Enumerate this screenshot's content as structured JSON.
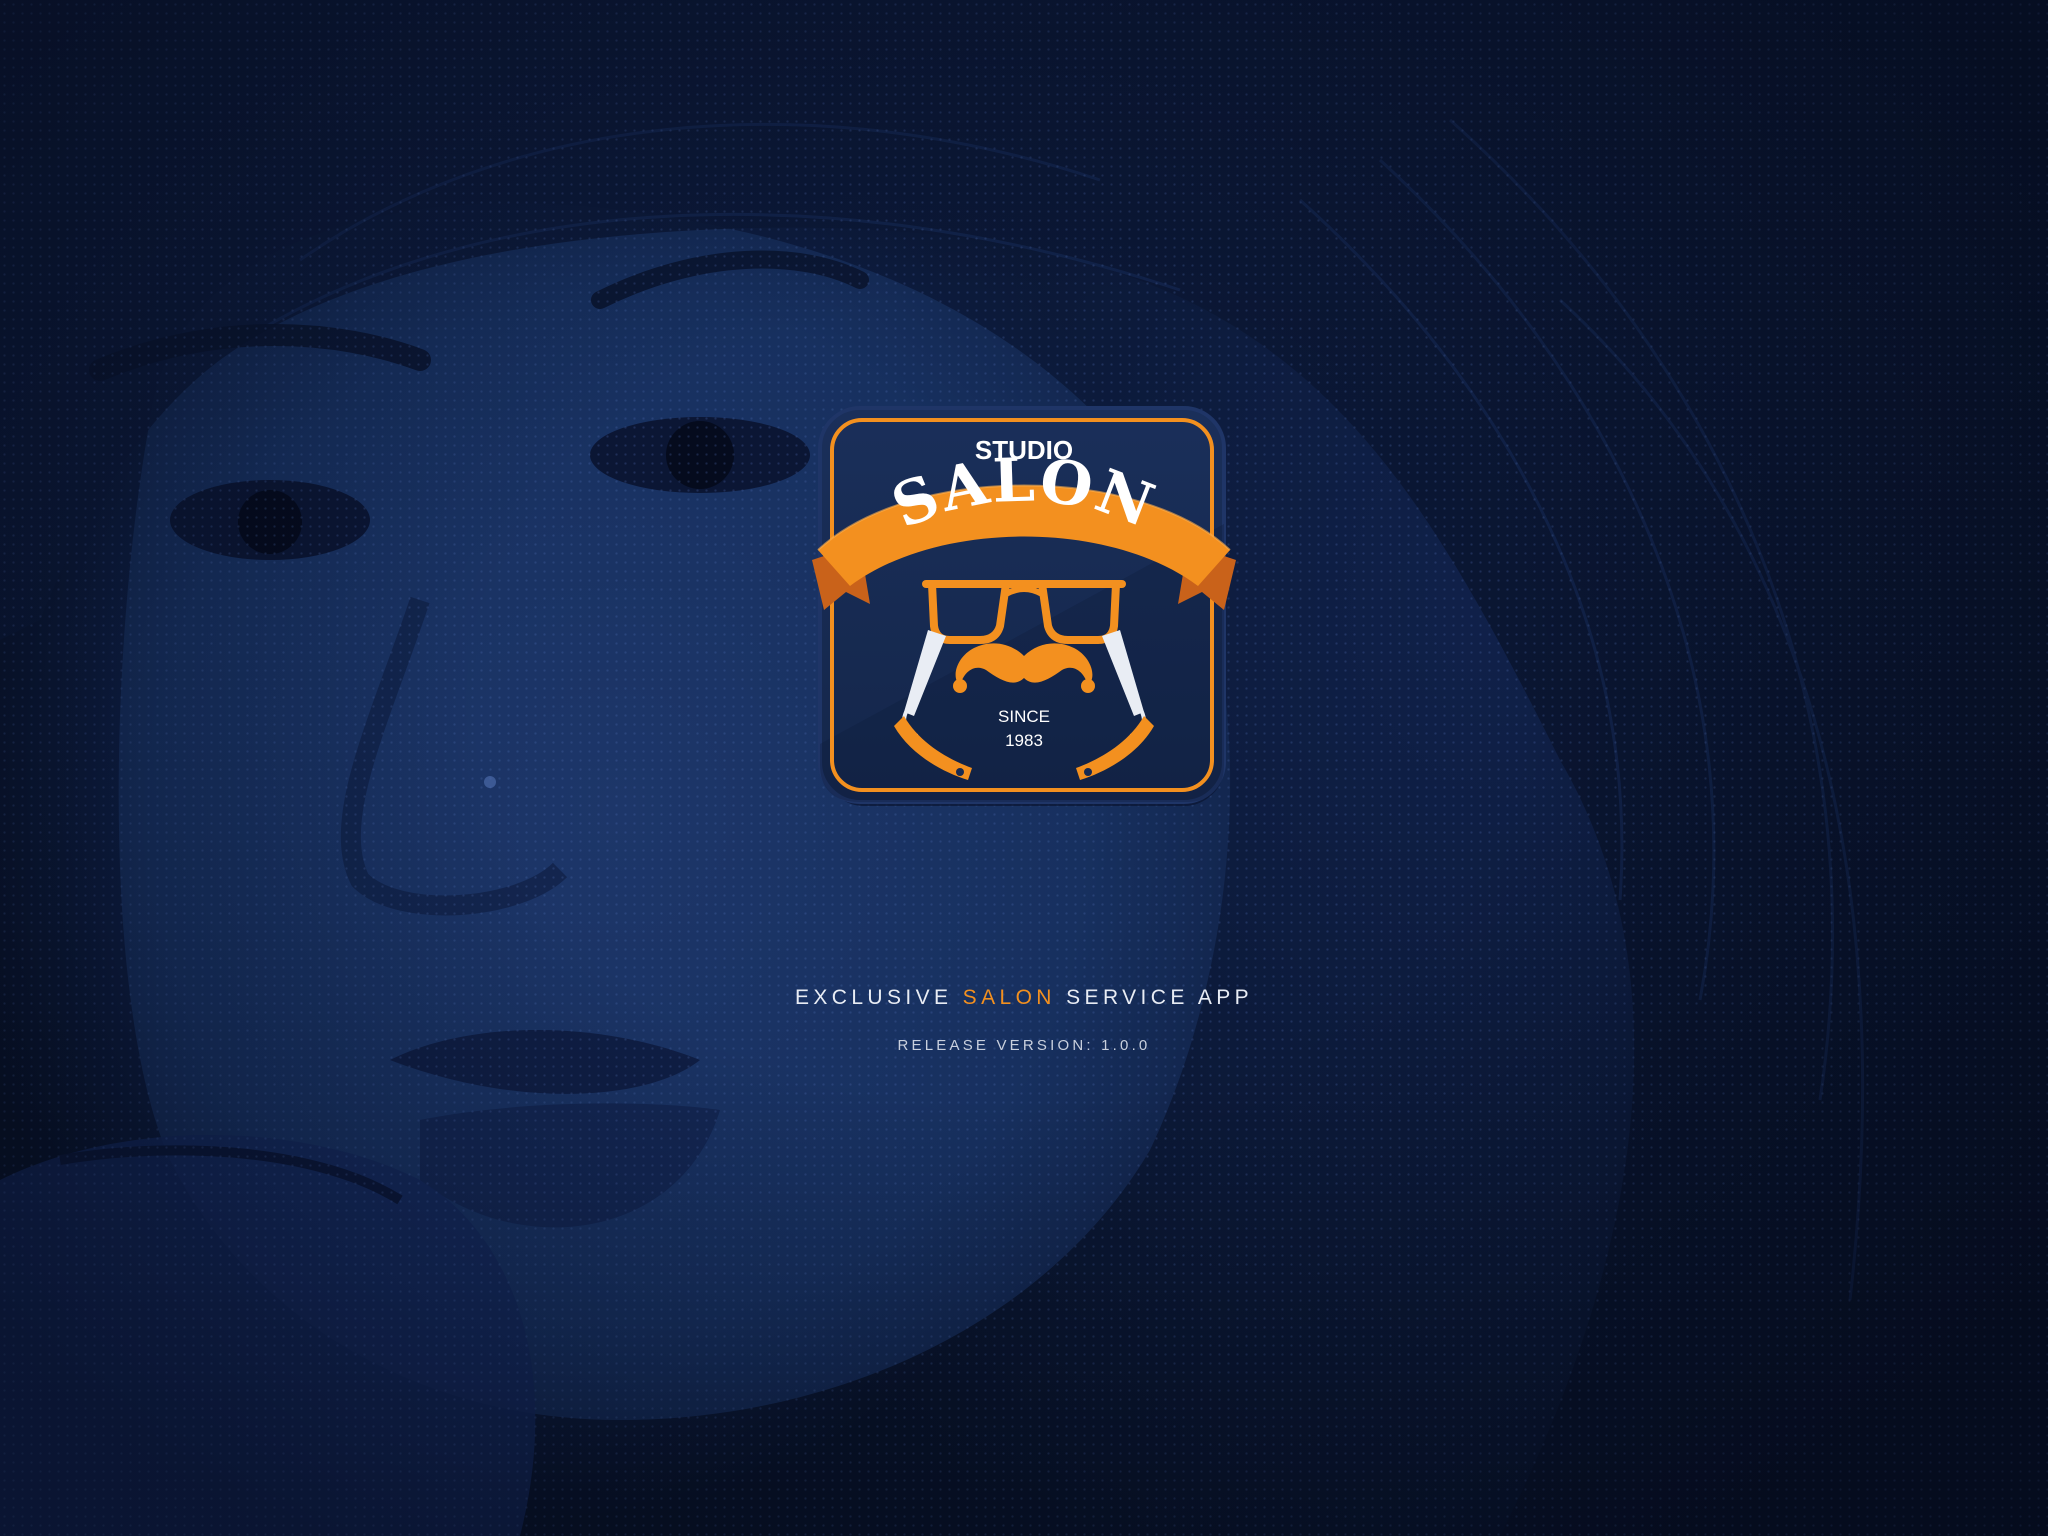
{
  "splash": {
    "logo": {
      "top_text": "STUDIO",
      "main_text": "SALON",
      "since_label": "SINCE",
      "since_year": "1983"
    },
    "tagline": {
      "prefix": "EXCLUSIVE",
      "highlight": "SALON",
      "suffix": "SERVICE APP"
    },
    "release": "RELEASE VERSION: 1.0.0"
  },
  "colors": {
    "background": "#0b1733",
    "badge_fill": "#172a52",
    "accent": "#f3901f",
    "accent_dark": "#c9621a",
    "text_light": "#e8ecf4"
  },
  "icons": [
    "sunglasses-icon",
    "mustache-icon",
    "straight-razor-icon",
    "ribbon-banner"
  ]
}
